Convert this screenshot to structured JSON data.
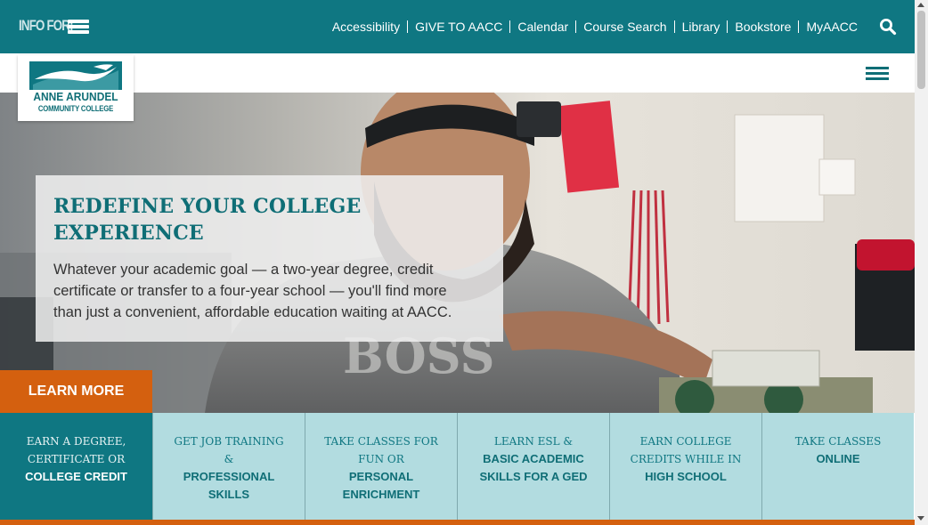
{
  "topbar": {
    "info_for_label": "INFO FOR:",
    "utility_links": [
      "Accessibility",
      "GIVE TO AACC",
      "Calendar",
      "Course Search",
      "Library",
      "Bookstore",
      "MyAACC"
    ],
    "search_icon": "search-icon",
    "menu_icon": "hamburger-menu-icon"
  },
  "header": {
    "logo_line1": "ANNE ARUNDEL",
    "logo_line2": "COMMUNITY COLLEGE",
    "menu_icon": "hamburger-menu-icon"
  },
  "hero": {
    "title": "REDEFINE YOUR COLLEGE EXPERIENCE",
    "text": "Whatever your academic goal — a two-year degree, credit certificate or transfer to a four-year school — you'll find more than just a convenient, affordable education waiting at AACC.",
    "cta": "LEARN MORE"
  },
  "tiles": [
    {
      "top": "Earn a degree, certificate or",
      "bottom": "College credit"
    },
    {
      "top": "Get job training &",
      "bottom": "Professional skills"
    },
    {
      "top": "Take classes for fun or",
      "bottom": "Personal enrichment"
    },
    {
      "top": "Learn ESL &",
      "bottom": "Basic academic skills for a GED"
    },
    {
      "top": "Earn college credits while in",
      "bottom": "High school"
    },
    {
      "top": "Take classes",
      "bottom": "Online"
    }
  ],
  "colors": {
    "teal": "#0f7782",
    "light_teal": "#b2dce0",
    "orange": "#d4600f"
  }
}
